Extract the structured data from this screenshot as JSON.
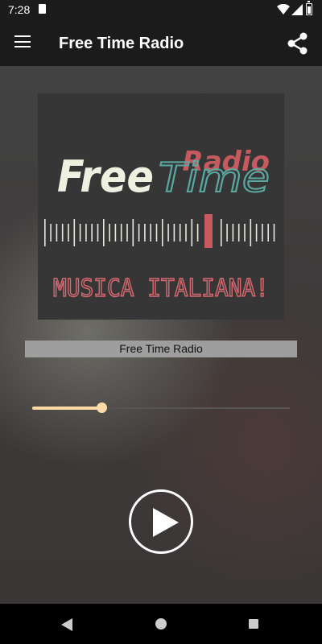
{
  "status_bar": {
    "time": "7:28",
    "icons": [
      "sd-card-icon",
      "wifi-icon",
      "signal-icon",
      "battery-icon"
    ]
  },
  "app_bar": {
    "title": "Free Time Radio",
    "menu_icon": "menu-icon",
    "share_icon": "share-icon"
  },
  "logo": {
    "title_part1": "Free",
    "title_part2": "Time",
    "radio_label": "Radio",
    "tagline": "MUSICA ITALIANA!"
  },
  "player": {
    "station_name": "Free Time Radio",
    "volume_level": 0.27,
    "play_icon": "play-icon"
  },
  "nav_bar": {
    "icons": [
      "back-icon",
      "home-icon",
      "recents-icon"
    ]
  },
  "colors": {
    "accent": "#ffd9a6",
    "logo_free": "#eef0e0",
    "logo_time": "#5aa8a0",
    "logo_red": "#c75a5f",
    "app_bar": "#1b1b1b"
  }
}
